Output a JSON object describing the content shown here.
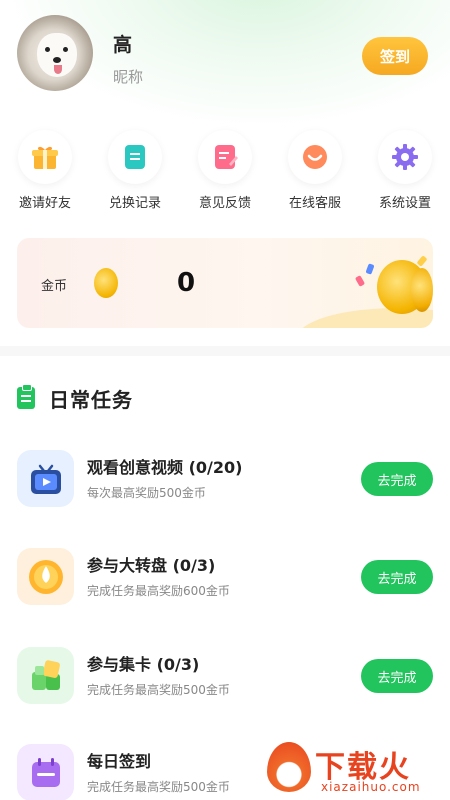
{
  "profile": {
    "name": "高",
    "nickname": "昵称",
    "signin_label": "签到"
  },
  "shortcuts": [
    {
      "label": "邀请好友",
      "icon": "gift-icon"
    },
    {
      "label": "兑换记录",
      "icon": "record-icon"
    },
    {
      "label": "意见反馈",
      "icon": "feedback-icon"
    },
    {
      "label": "在线客服",
      "icon": "chat-icon"
    },
    {
      "label": "系统设置",
      "icon": "gear-icon"
    }
  ],
  "coins": {
    "label": "金币",
    "value": "0"
  },
  "daily_tasks": {
    "title": "日常任务",
    "items": [
      {
        "title": "观看创意视频 (0/20)",
        "subtitle": "每次最高奖励500金币",
        "button": "去完成",
        "icon": "tv-icon"
      },
      {
        "title": "参与大转盘 (0/3)",
        "subtitle": "完成任务最高奖励600金币",
        "button": "去完成",
        "icon": "wheel-icon"
      },
      {
        "title": "参与集卡 (0/3)",
        "subtitle": "完成任务最高奖励500金币",
        "button": "去完成",
        "icon": "cards-icon"
      },
      {
        "title": "每日签到",
        "subtitle": "完成任务最高奖励500金币",
        "button": "",
        "icon": "calendar-icon"
      }
    ]
  },
  "watermark": {
    "text": "下载火",
    "url": "xiazaihuo.com"
  },
  "colors": {
    "accent_green": "#22c45e",
    "signin_orange": "#f6a821",
    "coin_gold": "#f4b400",
    "watermark_red": "#e8431f"
  }
}
